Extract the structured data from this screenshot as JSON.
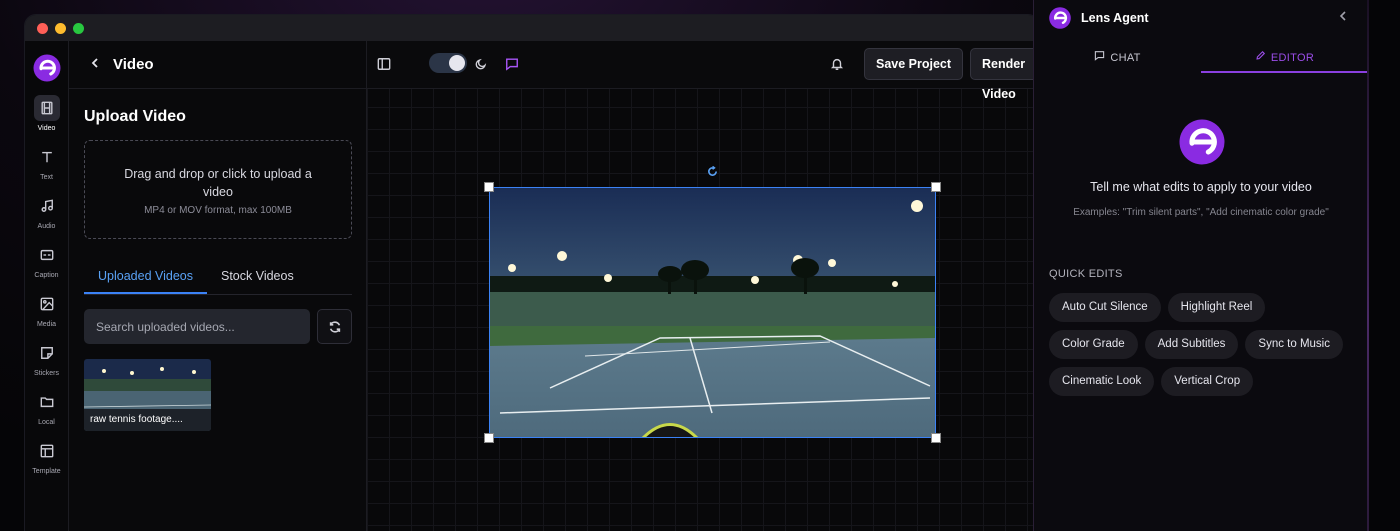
{
  "colors": {
    "accent": "#8a3fe0",
    "blue": "#3b82f6",
    "background": "#0a0a0c"
  },
  "header": {
    "back_icon": "chevron-left-icon",
    "title": "Video"
  },
  "rail": {
    "items": [
      {
        "label": "Video",
        "icon": "film-icon"
      },
      {
        "label": "Text",
        "icon": "text-icon"
      },
      {
        "label": "Audio",
        "icon": "music-icon"
      },
      {
        "label": "Caption",
        "icon": "caption-icon"
      },
      {
        "label": "Media",
        "icon": "image-icon"
      },
      {
        "label": "Stickers",
        "icon": "sticker-icon"
      },
      {
        "label": "Local",
        "icon": "folder-icon"
      },
      {
        "label": "Template",
        "icon": "layout-icon"
      }
    ]
  },
  "upload": {
    "title": "Upload Video",
    "dropzone_text": "Drag and drop or click to upload a video",
    "dropzone_hint": "MP4 or MOV format, max 100MB"
  },
  "tabs": {
    "uploaded": "Uploaded Videos",
    "stock": "Stock Videos"
  },
  "search": {
    "placeholder": "Search uploaded videos..."
  },
  "videos": [
    {
      "name": "raw tennis footage...."
    }
  ],
  "toolbar": {
    "save_label": "Save Project",
    "render_label": "Render Video"
  },
  "agent": {
    "title": "Lens Agent",
    "tab_chat": "CHAT",
    "tab_editor": "EDITOR",
    "prompt": "Tell me what edits to apply to your video",
    "examples": "Examples: \"Trim silent parts\", \"Add cinematic color grade\"",
    "quick_edits_title": "QUICK EDITS",
    "quick_edits": [
      "Auto Cut Silence",
      "Highlight Reel",
      "Color Grade",
      "Add Subtitles",
      "Sync to Music",
      "Cinematic Look",
      "Vertical Crop"
    ]
  }
}
